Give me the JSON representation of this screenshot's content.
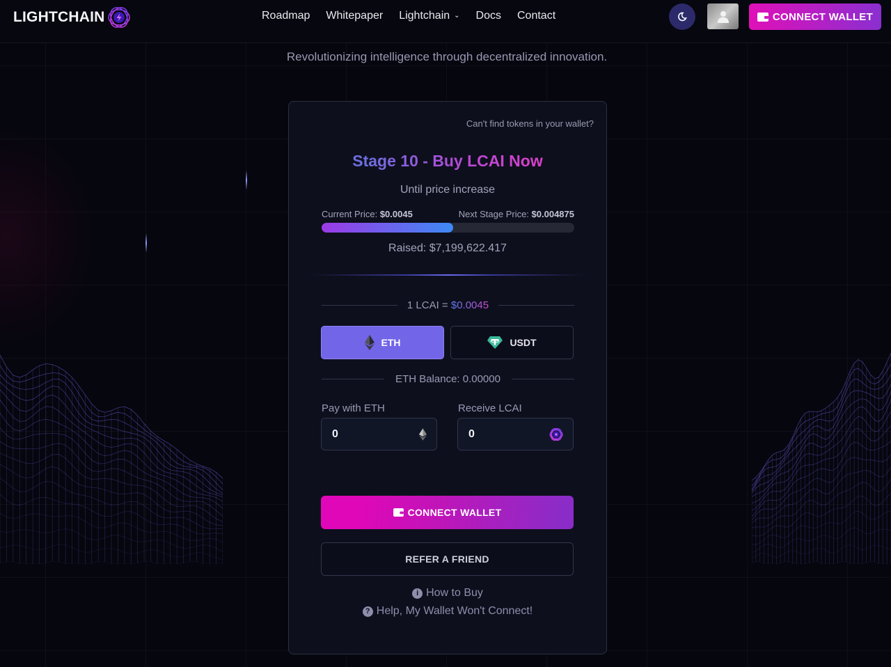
{
  "nav": {
    "logo_text": "LIGHTCHAIN",
    "links": [
      {
        "label": "Roadmap",
        "has_dropdown": false
      },
      {
        "label": "Whitepaper",
        "has_dropdown": false
      },
      {
        "label": "Lightchain",
        "has_dropdown": true
      },
      {
        "label": "Docs",
        "has_dropdown": false
      },
      {
        "label": "Contact",
        "has_dropdown": false
      }
    ],
    "theme_icon": "moon-icon",
    "avatar_icon": "user-icon",
    "connect_label": "CONNECT WALLET"
  },
  "tagline": "Revolutionizing intelligence through decentralized innovation.",
  "presale": {
    "cant_find_link": "Can't find tokens in your wallet?",
    "title": "Stage 10 - Buy LCAI Now",
    "countdown_label": "Until price increase",
    "current_price_label": "Current Price:",
    "current_price": "$0.0045",
    "next_price_label": "Next Stage Price:",
    "next_price": "$0.004875",
    "progress_percent": 52,
    "raised": "Raised: $7,199,622.417",
    "rate_prefix": "1 LCAI = ",
    "rate_value": "$0.0045",
    "currencies": [
      {
        "label": "ETH",
        "icon": "ethereum-icon",
        "selected": true
      },
      {
        "label": "USDT",
        "icon": "tether-icon",
        "selected": false
      }
    ],
    "balance": "ETH Balance: 0.00000",
    "pay_label": "Pay with ETH",
    "pay_value": "0",
    "receive_label": "Receive LCAI",
    "receive_value": "0",
    "connect_label": "CONNECT WALLET",
    "refer_label": "REFER A FRIEND",
    "how_to_buy": "How to Buy",
    "help_wallet": "Help, My Wallet Won't Connect!"
  },
  "colors": {
    "accent_pink": "#e010b8",
    "accent_purple": "#7265e8",
    "background": "#06060e",
    "card": "#0e0f1d"
  }
}
